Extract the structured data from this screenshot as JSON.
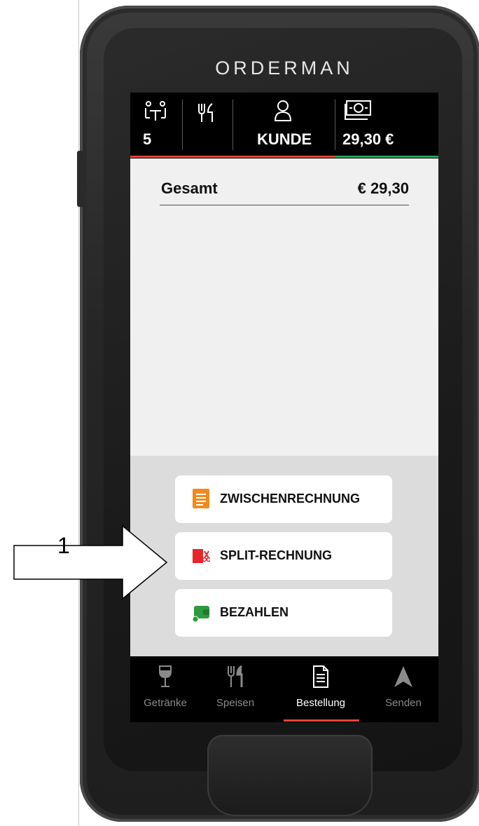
{
  "device": {
    "brand": "ORDERMAN"
  },
  "topbar": {
    "guests_icon": "table-guests-icon",
    "guests_count": "5",
    "cutlery_icon": "cutlery-icon",
    "customer_icon": "customer-icon",
    "customer_label": "KUNDE",
    "money_icon": "cash-note-icon",
    "amount": "29,30 €"
  },
  "order": {
    "total_label": "Gesamt",
    "total_value": "€ 29,30"
  },
  "actions": [
    {
      "label": "ZWISCHENRECHNUNG",
      "icon": "interim-bill-icon",
      "color": "#f08a1c"
    },
    {
      "label": "SPLIT-RECHNUNG",
      "icon": "split-bill-icon",
      "color": "#e8252b"
    },
    {
      "label": "BEZAHLEN",
      "icon": "pay-wallet-icon",
      "color": "#2e9a3f"
    }
  ],
  "nav": [
    {
      "label": "Getränke",
      "icon": "wine-glass-icon",
      "active": false
    },
    {
      "label": "Speisen",
      "icon": "cutlery-icon",
      "active": false
    },
    {
      "label": "Bestellung",
      "icon": "order-document-icon",
      "active": true
    },
    {
      "label": "Senden",
      "icon": "send-arrow-icon",
      "active": false
    }
  ],
  "annotation": {
    "callout_number": "1"
  },
  "colors": {
    "accent_red": "#e8433a",
    "accent_green": "#2aa45a"
  }
}
